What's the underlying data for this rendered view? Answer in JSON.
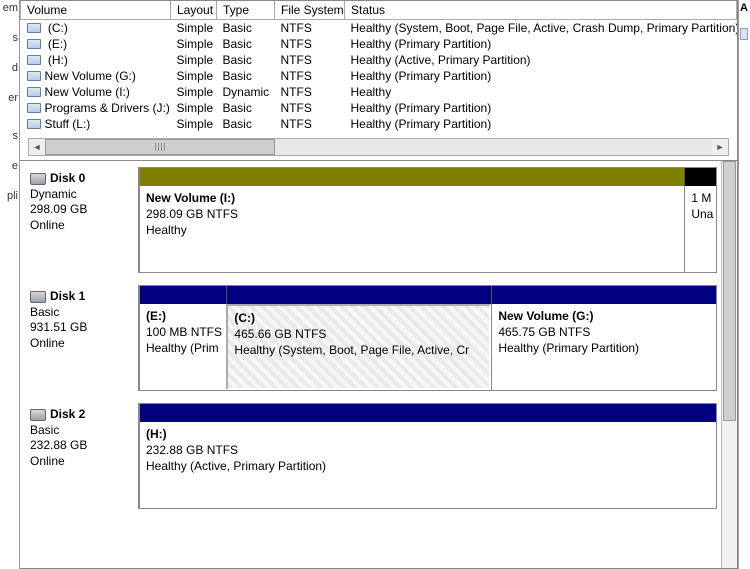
{
  "columns": {
    "volume": "Volume",
    "layout": "Layout",
    "type": "Type",
    "fs": "File System",
    "status": "Status"
  },
  "volumes": [
    {
      "name": " (C:)",
      "layout": "Simple",
      "type": "Basic",
      "fs": "NTFS",
      "status": "Healthy (System, Boot, Page File, Active, Crash Dump, Primary Partition)"
    },
    {
      "name": " (E:)",
      "layout": "Simple",
      "type": "Basic",
      "fs": "NTFS",
      "status": "Healthy (Primary Partition)"
    },
    {
      "name": " (H:)",
      "layout": "Simple",
      "type": "Basic",
      "fs": "NTFS",
      "status": "Healthy (Active, Primary Partition)"
    },
    {
      "name": "New Volume (G:)",
      "layout": "Simple",
      "type": "Basic",
      "fs": "NTFS",
      "status": "Healthy (Primary Partition)"
    },
    {
      "name": "New Volume (I:)",
      "layout": "Simple",
      "type": "Dynamic",
      "fs": "NTFS",
      "status": "Healthy"
    },
    {
      "name": "Programs & Drivers (J:)",
      "layout": "Simple",
      "type": "Basic",
      "fs": "NTFS",
      "status": "Healthy (Primary Partition)"
    },
    {
      "name": "Stuff (L:)",
      "layout": "Simple",
      "type": "Basic",
      "fs": "NTFS",
      "status": "Healthy (Primary Partition)"
    }
  ],
  "disks": {
    "d0": {
      "name": "Disk 0",
      "type": "Dynamic",
      "size": "298.09 GB",
      "state": "Online",
      "p0": {
        "title": "New Volume  (I:)",
        "sub": "298.09 GB NTFS",
        "status": "Healthy"
      },
      "p1": {
        "title": "1 M",
        "sub": "Una"
      }
    },
    "d1": {
      "name": "Disk 1",
      "type": "Basic",
      "size": "931.51 GB",
      "state": "Online",
      "p0": {
        "title": " (E:)",
        "sub": "100 MB NTFS",
        "status": "Healthy (Prim"
      },
      "p1": {
        "title": " (C:)",
        "sub": "465.66 GB NTFS",
        "status": "Healthy (System, Boot, Page File, Active, Cr"
      },
      "p2": {
        "title": "New Volume  (G:)",
        "sub": "465.75 GB NTFS",
        "status": "Healthy (Primary Partition)"
      }
    },
    "d2": {
      "name": "Disk 2",
      "type": "Basic",
      "size": "232.88 GB",
      "state": "Online",
      "p0": {
        "title": " (H:)",
        "sub": "232.88 GB NTFS",
        "status": "Healthy (Active, Primary Partition)"
      }
    }
  },
  "right_label": "A",
  "colors": {
    "olive": "#808000",
    "navy": "#000080",
    "black": "#000000"
  }
}
